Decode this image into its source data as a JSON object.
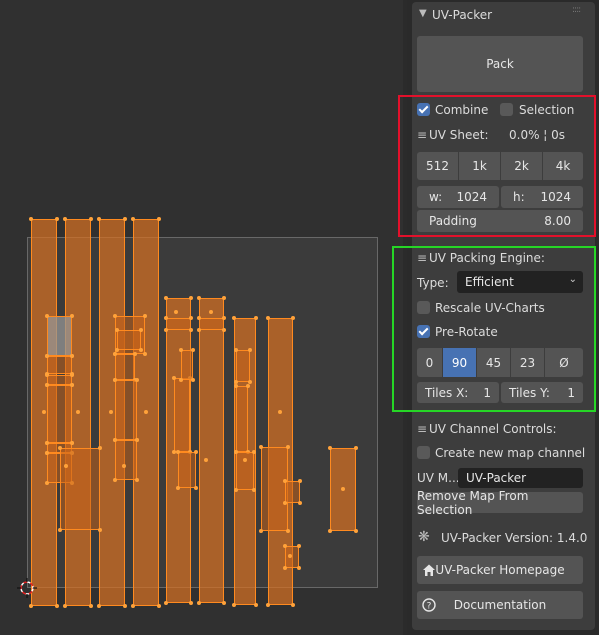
{
  "panel": {
    "title": "UV-Packer",
    "pack_label": "Pack",
    "combine_label": "Combine",
    "combine_checked": true,
    "selection_label": "Selection",
    "selection_checked": false,
    "uv_sheet_label": "UV Sheet:",
    "uv_sheet_status": "0.0% ¦ 0s",
    "resolutions": [
      "512",
      "1k",
      "2k",
      "4k"
    ],
    "width_label": "w:",
    "width_value": "1024",
    "height_label": "h:",
    "height_value": "1024",
    "padding_label": "Padding",
    "padding_value": "8.00",
    "engine_label": "UV Packing Engine:",
    "type_label": "Type:",
    "type_value": "Efficient",
    "rescale_label": "Rescale UV-Charts",
    "rescale_checked": false,
    "prerotate_label": "Pre-Rotate",
    "prerotate_checked": true,
    "rotations": [
      "0",
      "90",
      "45",
      "23",
      "Ø"
    ],
    "active_rotation": "90",
    "tiles_x_label": "Tiles X:",
    "tiles_x_value": "1",
    "tiles_y_label": "Tiles Y:",
    "tiles_y_value": "1",
    "channel_label": "UV Channel Controls:",
    "create_channel_label": "Create new map channel",
    "create_channel_checked": false,
    "uv_map_label": "UV M...",
    "uv_map_value": "UV-Packer",
    "remove_map_label": "Remove Map From Selection",
    "version_label": "UV-Packer Version: 1.4.0",
    "homepage_label": "UV-Packer Homepage",
    "documentation_label": "Documentation"
  },
  "icons": {
    "header": "chevron-down-icon",
    "drag": "drag-handle-icon",
    "list": "list-icon",
    "gear": "gear-icon",
    "home": "home-icon",
    "help": "question-icon",
    "cursor": "3d-cursor-icon"
  },
  "colors": {
    "island_fill": "#d67022",
    "island_edge": "#ff8a1f",
    "active_button": "#4772b3",
    "highlight_red": "#e3102b",
    "highlight_green": "#26d626"
  }
}
